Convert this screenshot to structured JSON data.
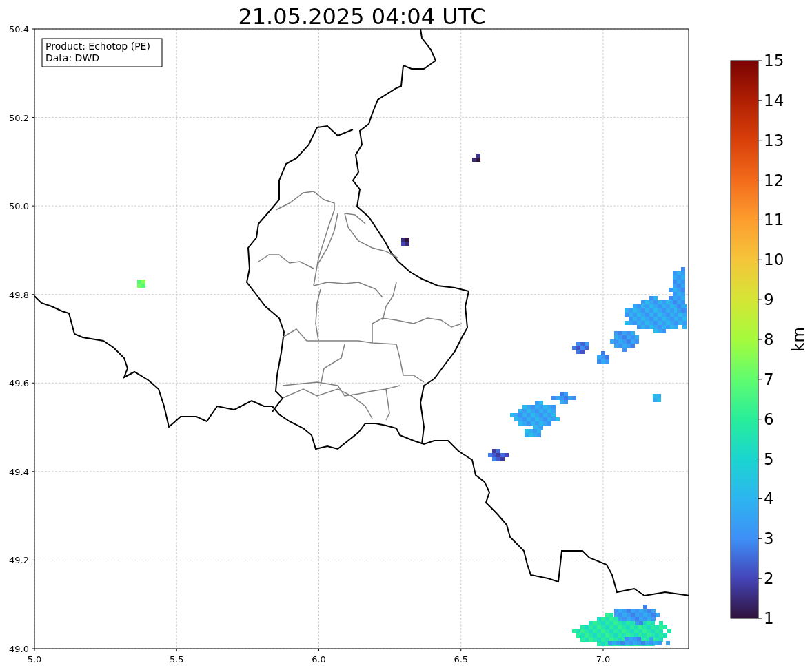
{
  "title": "21.05.2025 04:04 UTC",
  "legend": [
    "Product: Echotop (PE)",
    "Data: DWD"
  ],
  "x_ticks": [
    "5.0",
    "5.5",
    "6.0",
    "6.5",
    "7.0"
  ],
  "y_ticks": [
    "50.4",
    "50.2",
    "50.0",
    "49.8",
    "49.6",
    "49.4",
    "49.2",
    "49.0"
  ],
  "colorbar": {
    "label": "km",
    "ticks": [
      "15",
      "14",
      "13",
      "12",
      "11",
      "10",
      "9",
      "8",
      "7",
      "6",
      "5",
      "4",
      "3",
      "2",
      "1"
    ]
  }
}
